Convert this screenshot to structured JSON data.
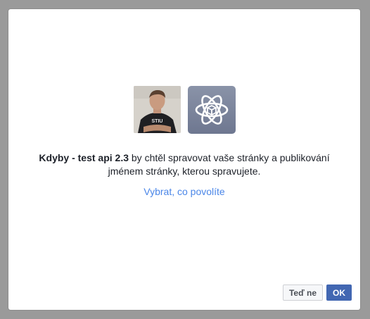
{
  "dialog": {
    "app_name": "Kdyby - test api 2.3",
    "message_part1": " by chtěl spravovat vaše stránky a publikování",
    "message_part2": "jménem stránky, kterou spravujete.",
    "choose_link": "Vybrat, co povolíte",
    "user_shirt_text": "STIU",
    "buttons": {
      "not_now": "Teď ne",
      "ok": "OK"
    }
  },
  "colors": {
    "link": "#4a86e8",
    "primary_button": "#4267b2",
    "app_icon_bg": "#7a8399"
  },
  "icons": {
    "user_avatar": "user-photo",
    "app_icon": "atom-icon"
  }
}
